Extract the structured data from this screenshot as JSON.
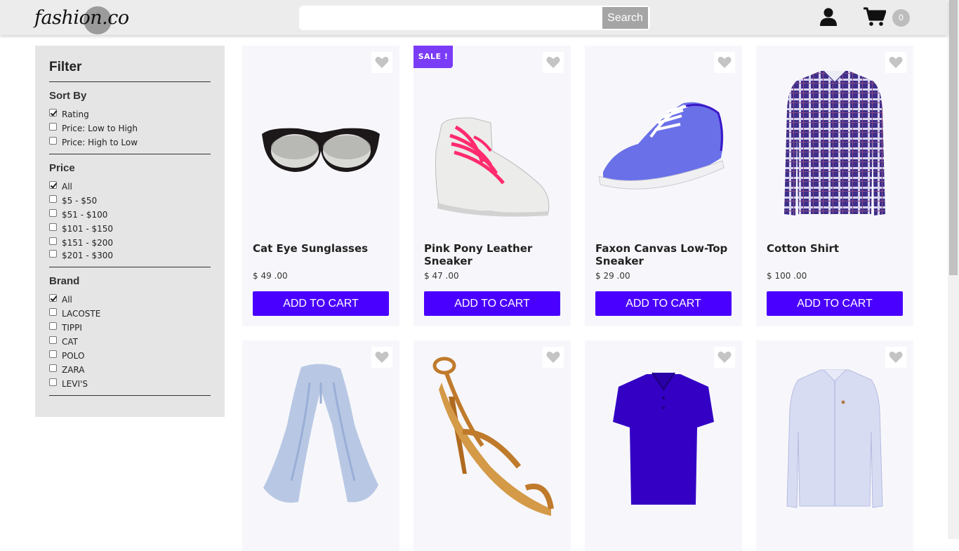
{
  "header": {
    "logo_text": "fashion.co",
    "search_placeholder": "",
    "search_label": "Search",
    "cart_count": "0"
  },
  "filter": {
    "title": "Filter",
    "sort": {
      "title": "Sort By",
      "options": [
        {
          "label": "Rating",
          "checked": true
        },
        {
          "label": "Price: Low to High",
          "checked": false
        },
        {
          "label": "Price: High to Low",
          "checked": false
        }
      ]
    },
    "price": {
      "title": "Price",
      "options": [
        {
          "label": "All",
          "checked": true
        },
        {
          "label": "$5 - $50",
          "checked": false
        },
        {
          "label": "$51 - $100",
          "checked": false
        },
        {
          "label": "$101 - $150",
          "checked": false
        },
        {
          "label": "$151 - $200",
          "checked": false
        },
        {
          "label": "$201 - $300",
          "checked": false
        }
      ]
    },
    "brand": {
      "title": "Brand",
      "options": [
        {
          "label": "All",
          "checked": true
        },
        {
          "label": "LACOSTE",
          "checked": false
        },
        {
          "label": "TIPPI",
          "checked": false
        },
        {
          "label": "CAT",
          "checked": false
        },
        {
          "label": "POLO",
          "checked": false
        },
        {
          "label": "ZARA",
          "checked": false
        },
        {
          "label": "LEVI'S",
          "checked": false
        }
      ]
    }
  },
  "products": [
    {
      "name": "Cat Eye Sunglasses",
      "price": "$ 49 .00",
      "button": "ADD TO CART",
      "sale": false
    },
    {
      "name": "Pink Pony Leather Sneaker",
      "price": "$ 47 .00",
      "button": "ADD TO CART",
      "sale": true,
      "sale_label": "SALE !"
    },
    {
      "name": "Faxon Canvas Low-Top Sneaker",
      "price": "$ 29 .00",
      "button": "ADD TO CART",
      "sale": false
    },
    {
      "name": "Cotton Shirt",
      "price": "$ 100 .00",
      "button": "ADD TO CART",
      "sale": false
    },
    {
      "name": "",
      "price": "",
      "button": "",
      "sale": false
    },
    {
      "name": "",
      "price": "",
      "button": "",
      "sale": false
    },
    {
      "name": "",
      "price": "",
      "button": "",
      "sale": false
    },
    {
      "name": "",
      "price": "",
      "button": "",
      "sale": false
    }
  ],
  "icons": {
    "user": "user-icon",
    "cart": "shopping-cart-icon",
    "heart": "heart-icon"
  },
  "colors": {
    "accent": "#4a00ff",
    "sale": "#7b3cf7",
    "heart": "#c4c4c4"
  }
}
